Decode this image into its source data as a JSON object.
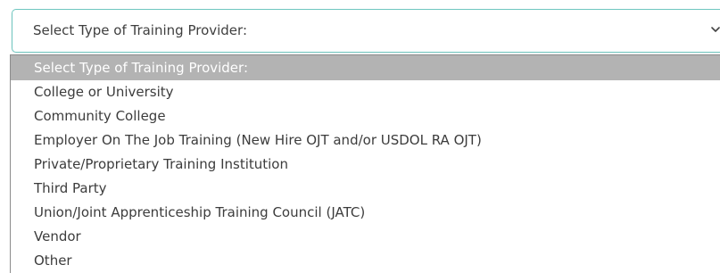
{
  "select": {
    "value": "Select Type of Training Provider:",
    "icon": "chevron-down-icon"
  },
  "dropdown": {
    "options": [
      "Select Type of Training Provider:",
      "College or University",
      "Community College",
      "Employer On The Job Training (New Hire OJT and/or USDOL RA OJT)",
      "Private/Proprietary Training Institution",
      "Third Party",
      "Union/Joint Apprenticeship Training Council (JATC)",
      "Vendor",
      "Other"
    ]
  }
}
